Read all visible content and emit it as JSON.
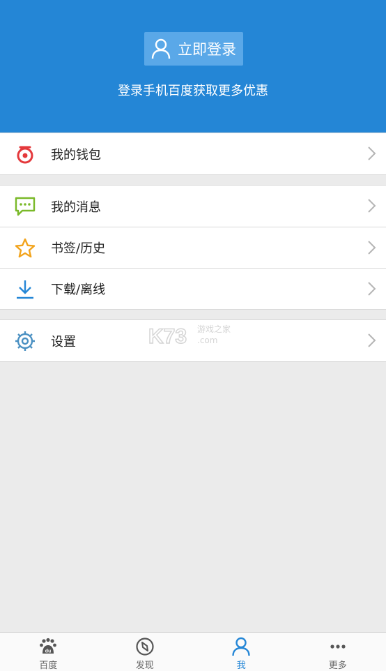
{
  "header": {
    "login_label": "立即登录",
    "subtitle": "登录手机百度获取更多优惠",
    "bg_color": "#2486d6"
  },
  "groups": [
    [
      {
        "label": "我的钱包",
        "icon": "wallet-icon",
        "color": "#e4393c"
      }
    ],
    [
      {
        "label": "我的消息",
        "icon": "message-icon",
        "color": "#7ab929"
      },
      {
        "label": "书签/历史",
        "icon": "star-icon",
        "color": "#f2a31b"
      },
      {
        "label": "下载/离线",
        "icon": "download-icon",
        "color": "#2486d6"
      }
    ],
    [
      {
        "label": "设置",
        "icon": "settings-icon",
        "color": "#4a90c2"
      }
    ]
  ],
  "watermark": {
    "main": "K73",
    "side": "游戏之家",
    "domain": ".com"
  },
  "tabbar": {
    "items": [
      {
        "label": "百度",
        "icon": "baidu-paw-icon",
        "active": false
      },
      {
        "label": "发现",
        "icon": "compass-icon",
        "active": false
      },
      {
        "label": "我",
        "icon": "user-icon",
        "active": true
      },
      {
        "label": "更多",
        "icon": "more-dots-icon",
        "active": false
      }
    ],
    "active_color": "#2486d6"
  }
}
